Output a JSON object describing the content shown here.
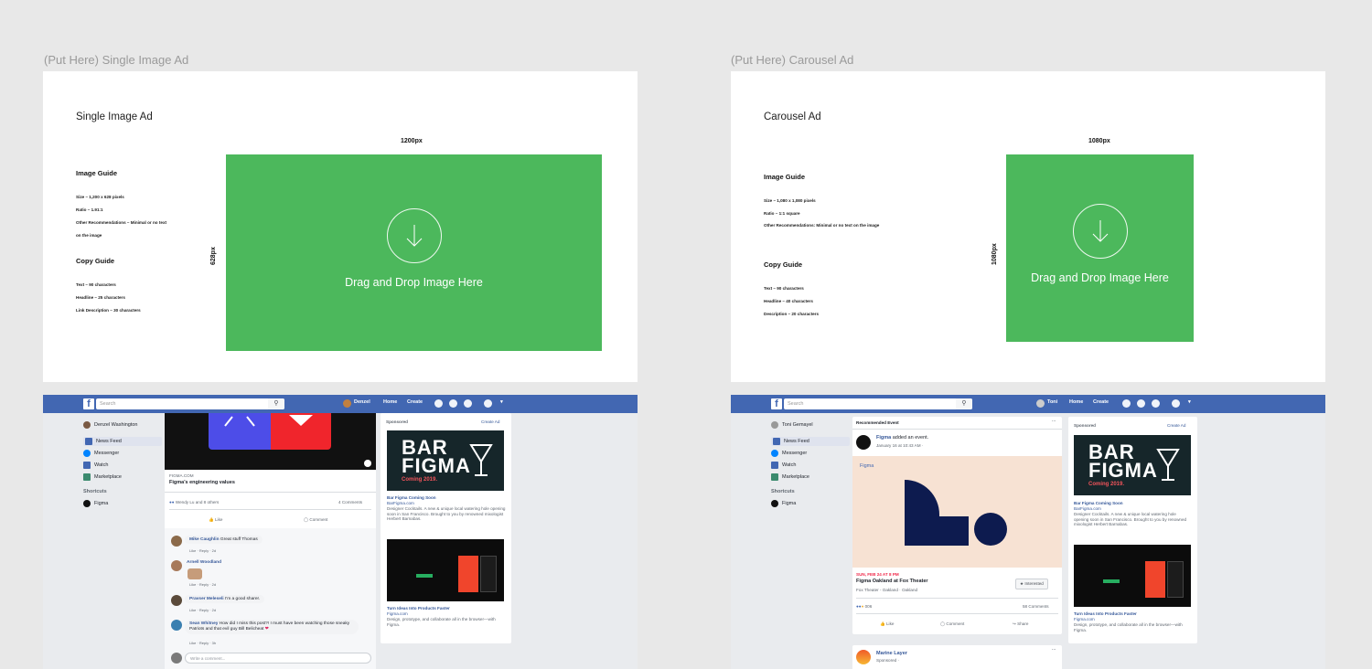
{
  "left_board": {
    "label": "(Put Here) Single Image Ad",
    "card_title": "Single Image Ad",
    "image_guide_heading": "Image Guide",
    "image_guide_lines": [
      "Size – 1,200 x 628 pixels",
      "Ratio – 1.91:1",
      "Other Recommendations – Minimal or no text",
      "on the image"
    ],
    "copy_guide_heading": "Copy Guide",
    "copy_guide_lines": [
      "Text – 90 characters",
      "Headline – 25 characters",
      "Link Description – 30 characters"
    ],
    "width_label": "1200px",
    "height_label": "628px",
    "drop_text": "Drag and Drop Image Here"
  },
  "right_board": {
    "label": "(Put Here) Carousel Ad",
    "card_title": "Carousel Ad",
    "image_guide_heading": "Image Guide",
    "image_guide_lines": [
      "Size – 1,080 x 1,080 pixels",
      "Ratio – 1:1 square",
      "Other Recommendations: Minimal or no text on the image"
    ],
    "copy_guide_heading": "Copy Guide",
    "copy_guide_lines": [
      "Text – 90 characters",
      "Headline – 40 characters",
      "Description – 20 characters"
    ],
    "width_label": "1080px",
    "height_label": "1080px",
    "drop_text": "Drag and Drop Image Here"
  },
  "fb_left": {
    "search_placeholder": "Search",
    "user_short": "Denzel",
    "nav_home": "Home",
    "nav_create": "Create",
    "user_full": "Denzel Washington",
    "sidebar": [
      "News Feed",
      "Messenger",
      "Watch",
      "Marketplace"
    ],
    "shortcuts_heading": "Shortcuts",
    "shortcut_item": "Figma",
    "post_domain": "FIGMA.COM",
    "post_title": "Figma's engineering values",
    "reactions": "Wendy Lu and 8 others",
    "comments_count": "4 Comments",
    "like": "Like",
    "comment": "Comment",
    "comments": [
      {
        "name": "Mike Caughlin",
        "text": "Great stuff Thomas",
        "meta": "Like · Reply · 2d"
      },
      {
        "name": "Arnell Woodland",
        "text": "",
        "meta": "Like · Reply · 2d"
      },
      {
        "name": "Pravser Meleseli",
        "text": "I'm a good sharer.",
        "meta": "Like · Reply · 2d"
      },
      {
        "name": "Sean Whitney",
        "text": "How did I miss this post?! I must have been watching those sneaky Patriots and that evil guy Bill Belicheat",
        "meta": "Like · Reply · 3h"
      }
    ],
    "write_comment": "Write a comment...",
    "sponsored": "Sponsored",
    "create_ad": "Create Ad",
    "ad_brand_line1": "BAR",
    "ad_brand_line2": "FIGMA",
    "ad_coming": "Coming 2019.",
    "ad1_title": "Bar Figma Coming Soon",
    "ad1_domain": "BarFigma.com",
    "ad1_desc": "Designer Cocktails. A new & unique local watering hole opening soon in San Francisco. Brought to you by renowned mixologist Herbert Barnabas.",
    "ad2_title": "Turn Ideas Into Products Faster",
    "ad2_domain": "Figma.com",
    "ad2_desc": "Design, prototype, and collaborate all in the browser—with Figma."
  },
  "fb_right": {
    "search_placeholder": "Search",
    "user_short": "Toni",
    "nav_home": "Home",
    "nav_create": "Create",
    "user_full": "Toni Gemayel",
    "sidebar": [
      "News Feed",
      "Messenger",
      "Watch",
      "Marketplace"
    ],
    "shortcuts_heading": "Shortcuts",
    "shortcut_item": "Figma",
    "rec_heading": "Recommended Event",
    "actor": "Figma",
    "actor_action": "added an event.",
    "actor_time": "January 16 at 10:43 AM · ",
    "event_brand": "Figma",
    "event_date": "SUN, FEB 24 AT 8 PM",
    "event_title": "Figma Oakland at Fox Theater",
    "event_place": "Fox Theater - Oakland · Oakland",
    "interested": "★ Interested",
    "reactions_count": "006",
    "comments_count": "58 Comments",
    "like": "Like",
    "comment": "Comment",
    "share": "Share",
    "next_page": "Marine Layer",
    "next_sponsored": "Sponsored · ",
    "sponsored": "Sponsored",
    "create_ad": "Create Ad",
    "ad_brand_line1": "BAR",
    "ad_brand_line2": "FIGMA",
    "ad_coming": "Coming 2019.",
    "ad1_title": "Bar Figma Coming Soon",
    "ad1_domain": "BarFigma.com",
    "ad1_desc": "Designer Cocktails. A new & unique local watering hole opening soon in San Francisco. Brought to you by renowned mixologist Herbert Barnabas.",
    "ad2_title": "Turn Ideas Into Products Faster",
    "ad2_domain": "Figma.com",
    "ad2_desc": "Design, prototype, and collaborate all in the browser—with Figma."
  },
  "colors": {
    "dropzone_green": "#4cb85c",
    "fb_blue": "#4267b2",
    "feed_bg": "#e9ebee",
    "event_bg": "#f7e2d3",
    "event_navy": "#0d1b4f"
  }
}
